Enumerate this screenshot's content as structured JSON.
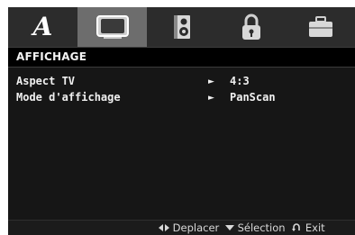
{
  "tabs": [
    {
      "name": "language-tab",
      "icon": "letter-a-icon",
      "selected": false
    },
    {
      "name": "display-tab",
      "icon": "tv-screen-icon",
      "selected": true
    },
    {
      "name": "audio-tab",
      "icon": "speaker-icon",
      "selected": false
    },
    {
      "name": "lock-tab",
      "icon": "padlock-icon",
      "selected": false
    },
    {
      "name": "others-tab",
      "icon": "briefcase-icon",
      "selected": false
    }
  ],
  "tab_letter": "A",
  "section": {
    "title": "AFFICHAGE"
  },
  "settings": [
    {
      "label": "Aspect TV",
      "arrow": "►",
      "value": "4:3"
    },
    {
      "label": "Mode d'affichage",
      "arrow": "►",
      "value": "PanScan"
    }
  ],
  "footer": {
    "move_icon": "left-right-arrows-icon",
    "move_label": "Deplacer",
    "select_icon": "down-triangle-icon",
    "select_label": "Sélection",
    "exit_icon": "return-arrow-icon",
    "exit_label": "Exit"
  },
  "colors": {
    "background": "#161616",
    "tab_bar": "#2c2c2c",
    "tab_selected": "#6d6d6d",
    "text": "#f0f0f0"
  }
}
